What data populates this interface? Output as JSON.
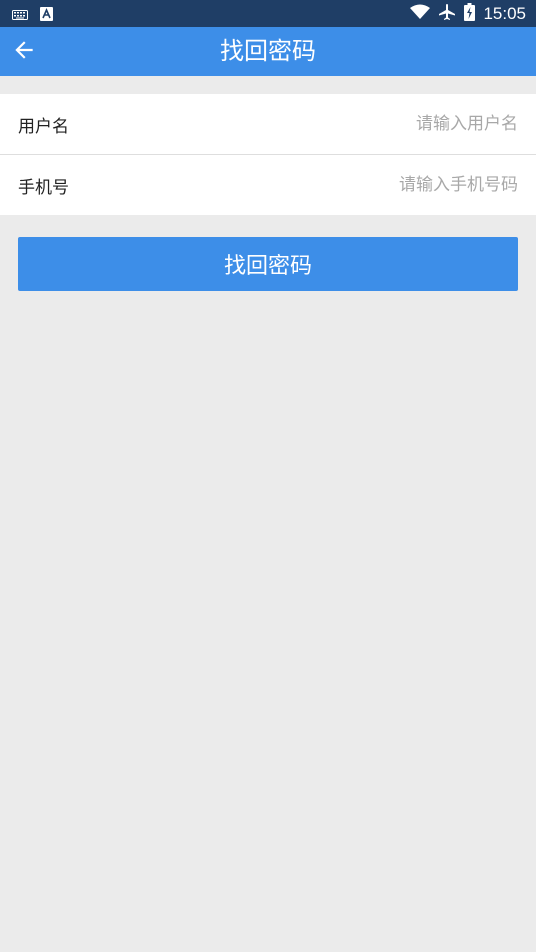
{
  "status_bar": {
    "time": "15:05",
    "icons": [
      "keyboard-icon",
      "text-input-icon",
      "wifi-icon",
      "airplane-icon",
      "battery-icon"
    ]
  },
  "header": {
    "title": "找回密码",
    "back_icon": "arrow-left-icon"
  },
  "form": {
    "username": {
      "label": "用户名",
      "value": "",
      "placeholder": "请输入用户名"
    },
    "phone": {
      "label": "手机号",
      "value": "",
      "placeholder": "请输入手机号码"
    }
  },
  "submit": {
    "label": "找回密码"
  },
  "colors": {
    "status_bar": "#1f3e66",
    "primary": "#3d8ee8",
    "background": "#ebebeb",
    "card": "#ffffff",
    "placeholder": "#a8a8a8"
  }
}
